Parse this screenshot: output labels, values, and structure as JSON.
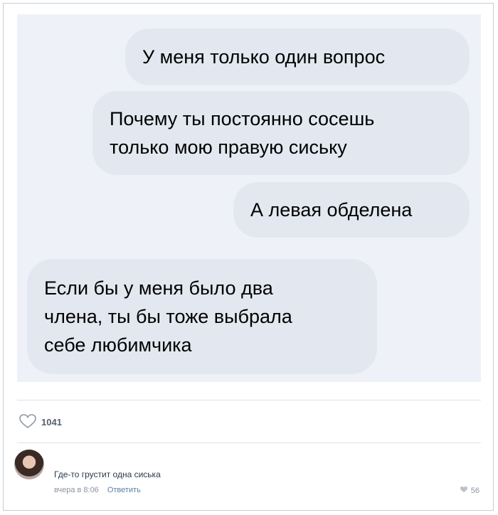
{
  "messages": [
    {
      "text": "У меня только один вопрос",
      "side": "right"
    },
    {
      "text": "Почему ты постоянно сосешь\nтолько мою правую сиську",
      "side": "right"
    },
    {
      "text": "А левая обделена",
      "side": "right"
    },
    {
      "text": "Если бы у меня было два\nчлена, ты бы тоже выбрала\nсебе любимчика",
      "side": "left"
    }
  ],
  "post": {
    "likes_count": "1041",
    "like_icon": "heart-outline-icon"
  },
  "comment": {
    "text": "Где-то грустит одна сиська",
    "time": "вчера в 8:06",
    "reply_label": "Ответить",
    "likes": "56",
    "like_icon": "heart-icon"
  },
  "colors": {
    "chat_bg": "#eef2f8",
    "bubble_bg": "#e3e8f0",
    "link": "#5d7fa5"
  }
}
